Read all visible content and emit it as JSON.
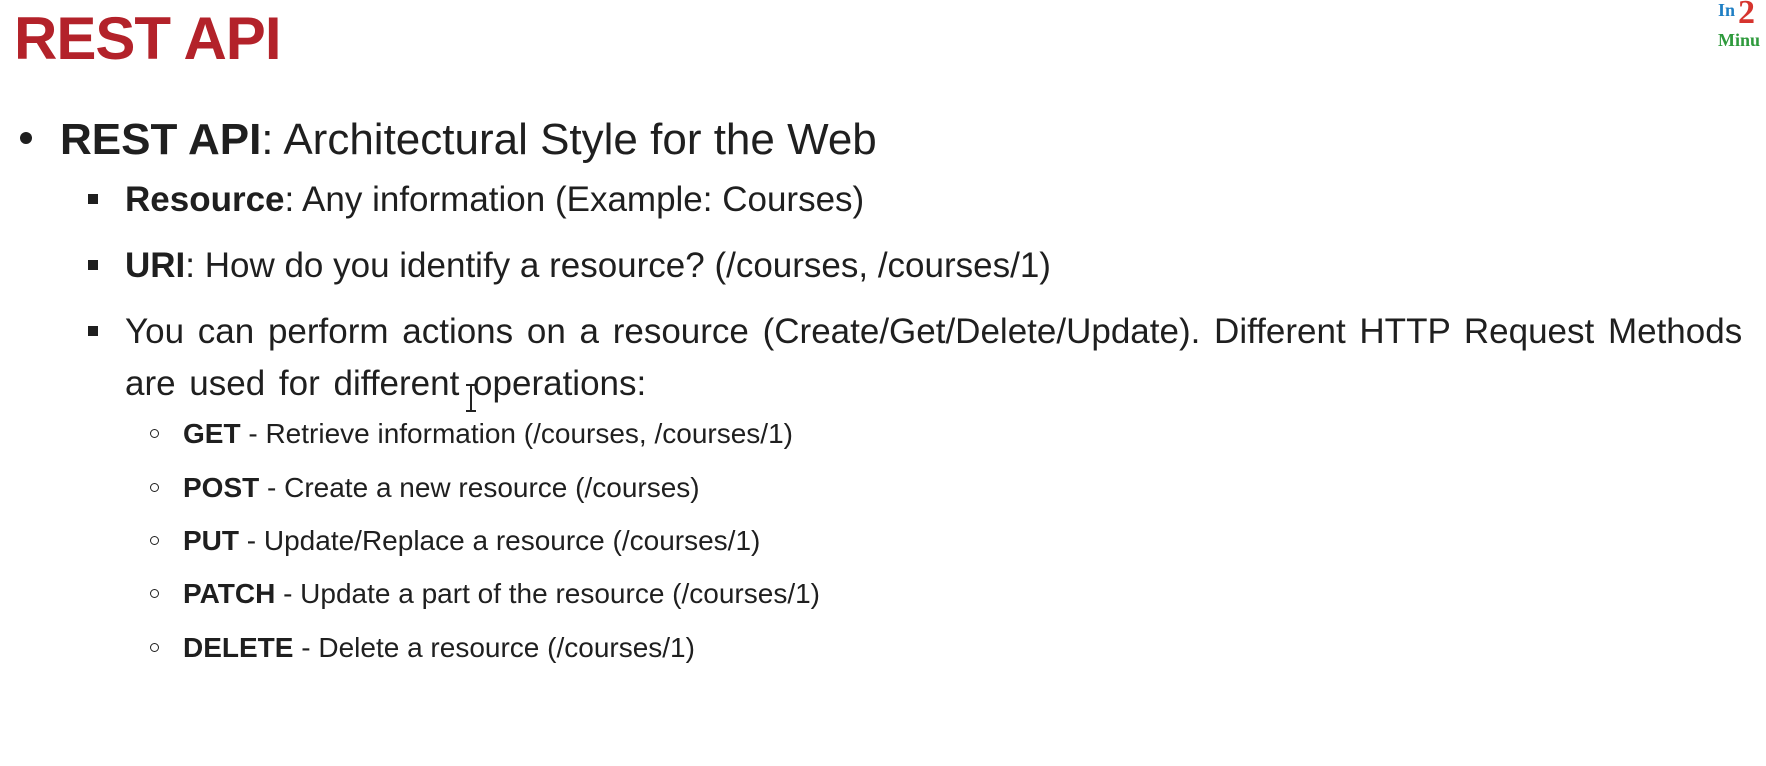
{
  "slide": {
    "title": "REST API",
    "logo": {
      "top_left": "In",
      "number": "2",
      "bottom": "Minu"
    }
  },
  "main_point": {
    "term": "REST API",
    "text": ": Architectural Style for the Web"
  },
  "sub_points": [
    {
      "term": "Resource",
      "text": ": Any information (Example: Courses)"
    },
    {
      "term": "URI",
      "text": ": How do you identify a resource? (/courses, /courses/1)"
    },
    {
      "term": "",
      "text": "You can perform actions on a resource (Create/Get/Delete/Update). Different HTTP Request Methods are used for different operations:"
    }
  ],
  "methods": [
    {
      "name": "GET",
      "desc": " - Retrieve information (/courses, /courses/1)"
    },
    {
      "name": "POST",
      "desc": " - Create a new resource (/courses)"
    },
    {
      "name": "PUT",
      "desc": " - Update/Replace a resource (/courses/1)"
    },
    {
      "name": "PATCH",
      "desc": " - Update a part of the resource (/courses/1)"
    },
    {
      "name": "DELETE",
      "desc": " - Delete a resource (/courses/1)"
    }
  ],
  "colors": {
    "title": "#b3222a",
    "text": "#1f1f1f",
    "logo_blue": "#1f7fc4",
    "logo_red": "#d6342e",
    "logo_green": "#2e9a3c"
  }
}
